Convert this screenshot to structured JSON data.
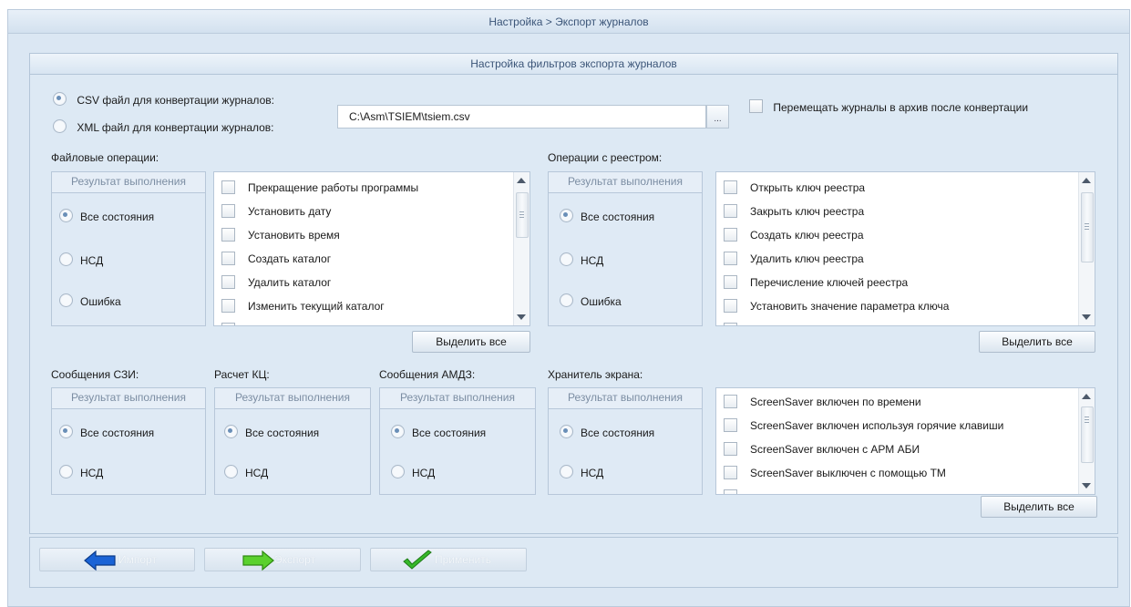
{
  "window": {
    "title": "Настройка > Экспорт журналов"
  },
  "panel": {
    "title": "Настройка фильтров экспорта журналов"
  },
  "format": {
    "csv_label": "CSV файл для конвертации журналов:",
    "xml_label": "XML файл для конвертации журналов:",
    "selected": "csv",
    "path_value": "C:\\Asm\\TSIEM\\tsiem.csv",
    "browse_label": "...",
    "archive_label": "Перемещать журналы в архив после конвертации"
  },
  "file_ops": {
    "title": "Файловые операции:",
    "group_header": "Результат выполнения",
    "radios": [
      "Все состояния",
      "НСД",
      "Ошибка"
    ],
    "items": [
      "Прекращение работы программы",
      "Установить дату",
      "Установить время",
      "Создать каталог",
      "Удалить каталог",
      "Изменить текущий каталог"
    ],
    "select_all": "Выделить все"
  },
  "registry_ops": {
    "title": "Операции с реестром:",
    "group_header": "Результат выполнения",
    "radios": [
      "Все состояния",
      "НСД",
      "Ошибка"
    ],
    "items": [
      "Открыть ключ реестра",
      "Закрыть ключ реестра",
      "Создать ключ реестра",
      "Удалить ключ реестра",
      "Перечисление ключей реестра",
      "Установить значение параметра ключа"
    ],
    "select_all": "Выделить все"
  },
  "szi": {
    "title": "Сообщения СЗИ:",
    "group_header": "Результат выполнения",
    "radios": [
      "Все состояния",
      "НСД"
    ]
  },
  "kc": {
    "title": "Расчет КЦ:",
    "group_header": "Результат выполнения",
    "radios": [
      "Все состояния",
      "НСД"
    ]
  },
  "amdz": {
    "title": "Сообщения АМДЗ:",
    "group_header": "Результат выполнения",
    "radios": [
      "Все состояния",
      "НСД"
    ]
  },
  "screensaver": {
    "title": "Хранитель экрана:",
    "group_header": "Результат выполнения",
    "radios": [
      "Все состояния",
      "НСД"
    ],
    "items": [
      "ScreenSaver включен по времени",
      "ScreenSaver включен используя горячие клавиши",
      "ScreenSaver включен с АРМ АБИ",
      "ScreenSaver выключен с помощью ТМ"
    ],
    "select_all": "Выделить все"
  },
  "buttons": {
    "import": "Импорт",
    "export": "Экспорт",
    "apply": "Применить"
  },
  "colors": {
    "window_bg": "#dbe7f3",
    "title_text": "#3b5578",
    "import_arrow": "#1a63d6",
    "export_arrow": "#5bd12e",
    "apply_check": "#36b82a"
  }
}
